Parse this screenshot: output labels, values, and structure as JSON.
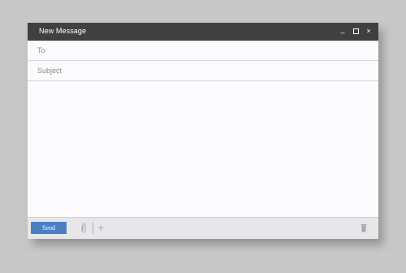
{
  "window": {
    "title": "New Message",
    "controls": {
      "minimize": "_",
      "close": "×"
    }
  },
  "fields": {
    "to_label": "To",
    "subject_label": "Subject"
  },
  "toolbar": {
    "send_label": "Send",
    "add_label": "+"
  }
}
